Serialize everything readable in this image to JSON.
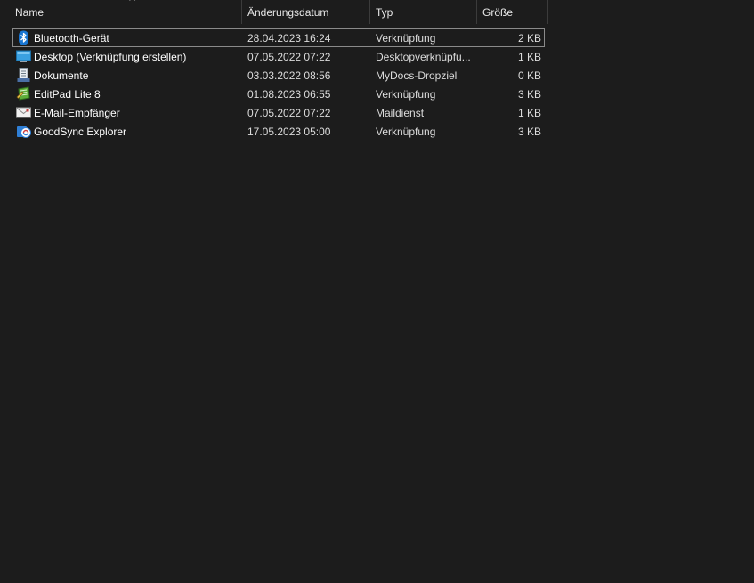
{
  "columns": {
    "name": "Name",
    "date": "Änderungsdatum",
    "type": "Typ",
    "size": "Größe",
    "sort_indicator": "^"
  },
  "files": [
    {
      "name": "Bluetooth-Gerät",
      "date": "28.04.2023 16:24",
      "type": "Verknüpfung",
      "size": "2 KB",
      "icon": "bluetooth-icon",
      "selected": true
    },
    {
      "name": "Desktop (Verknüpfung erstellen)",
      "date": "07.05.2022 07:22",
      "type": "Desktopverknüpfu...",
      "size": "1 KB",
      "icon": "desktop-icon"
    },
    {
      "name": "Dokumente",
      "date": "03.03.2022 08:56",
      "type": "MyDocs-Dropziel",
      "size": "0 KB",
      "icon": "documents-icon"
    },
    {
      "name": "EditPad Lite 8",
      "date": "01.08.2023 06:55",
      "type": "Verknüpfung",
      "size": "3 KB",
      "icon": "editpad-icon"
    },
    {
      "name": "E-Mail-Empfänger",
      "date": "07.05.2022 07:22",
      "type": "Maildienst",
      "size": "1 KB",
      "icon": "mail-icon"
    },
    {
      "name": "GoodSync Explorer",
      "date": "17.05.2023 05:00",
      "type": "Verknüpfung",
      "size": "3 KB",
      "icon": "goodsync-icon"
    }
  ],
  "colors": {
    "background": "#1c1c1c",
    "selection_border": "#8a8a8a",
    "column_separator": "#3b3b3b"
  }
}
